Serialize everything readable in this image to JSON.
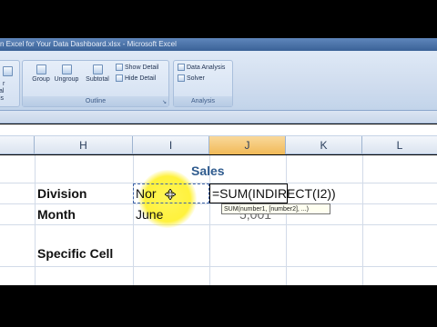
{
  "window": {
    "title": "n Excel for Your Data Dashboard.xlsx - Microsoft Excel"
  },
  "ribbon": {
    "left_fragment_top": "r",
    "left_fragment_mid": "al",
    "left_fragment_bottom": "is",
    "outline_group": {
      "title": "Outline",
      "group_label": "Group",
      "ungroup_label": "Ungroup",
      "subtotal_label": "Subtotal",
      "show_detail_label": "Show Detail",
      "hide_detail_label": "Hide Detail"
    },
    "analysis_group": {
      "title": "Analysis",
      "data_analysis_label": "Data Analysis",
      "solver_label": "Solver"
    }
  },
  "columns": [
    "H",
    "I",
    "J",
    "K",
    "L"
  ],
  "cells": {
    "sales_title": "Sales",
    "division_label": "Division",
    "division_value": "Nor",
    "formula_editing": "=SUM(INDIRECT(I2))",
    "month_label": "Month",
    "month_value": "June",
    "hidden_value": "5,001",
    "specific_cell_label": "Specific Cell"
  },
  "tooltip": {
    "text": "SUM(number1, [number2], ...)"
  },
  "colors": {
    "ribbon": "#cfdcee",
    "active_column": "#f1b957",
    "sales_title": "#2f5b8e",
    "highlight": "#fff028"
  }
}
